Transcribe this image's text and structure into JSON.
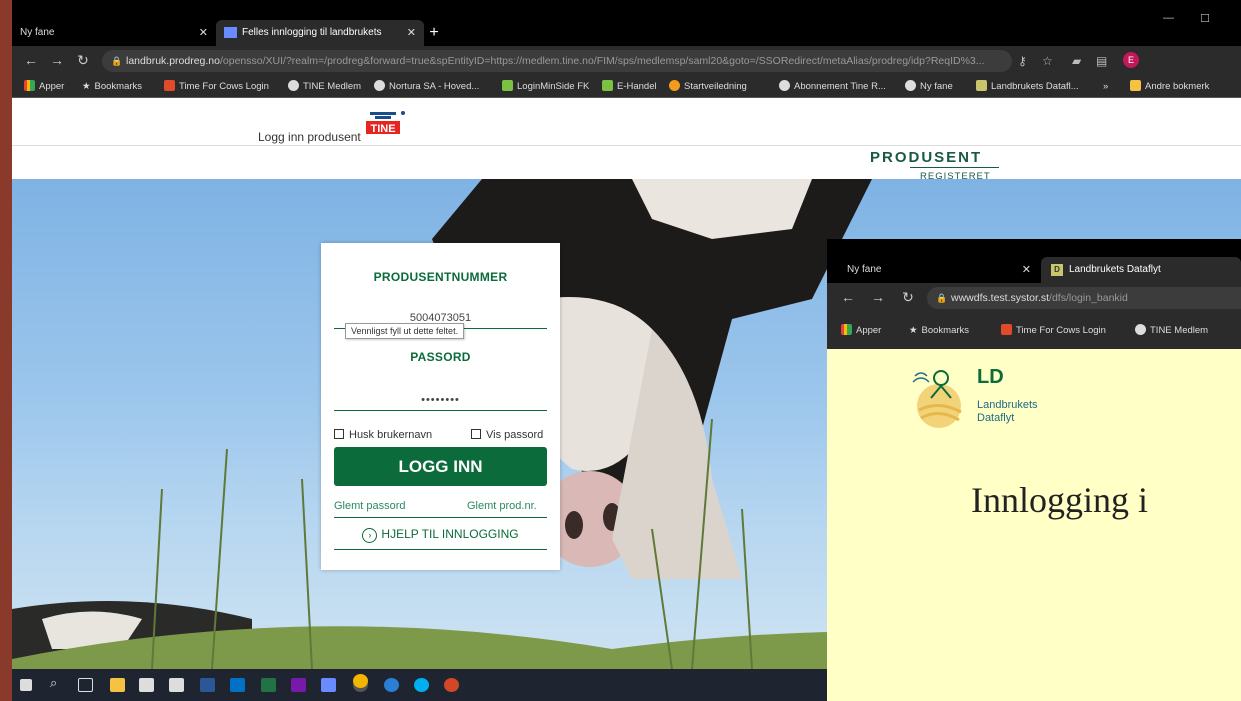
{
  "main_window": {
    "tabs": [
      {
        "label": "Ny fane"
      },
      {
        "label": "Felles innlogging til landbrukets"
      }
    ],
    "new_tab": "+",
    "url_host": "landbruk.prodreg.no",
    "url_rest": "/opensso/XUI/?realm=/prodreg&forward=true&spEntityID=https://medlem.tine.no/FIM/sps/medlemsp/saml20&goto=/SSORedirect/metaAlias/prodreg/idp?ReqID%3...",
    "bookmarks": [
      {
        "label": "Apper",
        "color": "#ea4335"
      },
      {
        "label": "Bookmarks",
        "color": "#ffffff"
      },
      {
        "label": "Time For Cows Login",
        "color": "#e04b2a"
      },
      {
        "label": "TINE Medlem",
        "color": "#dddddd"
      },
      {
        "label": "Nortura SA - Hoved...",
        "color": "#dddddd"
      },
      {
        "label": "LoginMinSide FK",
        "color": "#7cc242"
      },
      {
        "label": "E-Handel",
        "color": "#7cc242"
      },
      {
        "label": "Startveiledning",
        "color": "#f29b1d"
      },
      {
        "label": "Abonnement Tine R...",
        "color": "#dddddd"
      },
      {
        "label": "Ny fane",
        "color": "#dddddd"
      },
      {
        "label": "Landbrukets Datafl...",
        "color": "#c8c56a"
      }
    ],
    "bookmarks_overflow": "»",
    "other_bookmarks": "Andre bokmerk",
    "profile_letter": "E"
  },
  "page": {
    "login_producer_label": "Logg inn produsent",
    "tine_logo_text": "TINE",
    "brand_title": "PRODUSENT",
    "brand_subtitle": "REGISTERET",
    "login": {
      "producer_number_label": "PRODUSENTNUMMER",
      "producer_number_value": "5004073051",
      "tooltip": "Vennligst fyll ut dette feltet.",
      "password_label": "PASSORD",
      "password_value": "••••••••",
      "remember_username": "Husk brukernavn",
      "show_password": "Vis passord",
      "login_button": "LOGG INN",
      "forgot_password": "Glemt passord",
      "forgot_prodnr": "Glemt prod.nr.",
      "help_login": "HJELP TIL INNLOGGING"
    }
  },
  "overlay_window": {
    "tabs": [
      {
        "label": "Ny fane"
      },
      {
        "label": "Landbrukets Dataflyt"
      }
    ],
    "tab_favicon": "D",
    "url_host": "wwwdfs.test.systor.st",
    "url_rest": "/dfs/login_bankid",
    "bookmarks": [
      {
        "label": "Apper",
        "color": "#ea4335"
      },
      {
        "label": "Bookmarks",
        "color": "#ffffff"
      },
      {
        "label": "Time For Cows Login",
        "color": "#e04b2a"
      },
      {
        "label": "TINE Medlem",
        "color": "#dddddd"
      }
    ],
    "logo_title": "LD",
    "logo_sub1": "Landbrukets",
    "logo_sub2": "Dataflyt",
    "heading": "Innlogging i"
  },
  "colors": {
    "brand_green": "#0b6b3a",
    "page_yellow": "#ffffc6"
  }
}
